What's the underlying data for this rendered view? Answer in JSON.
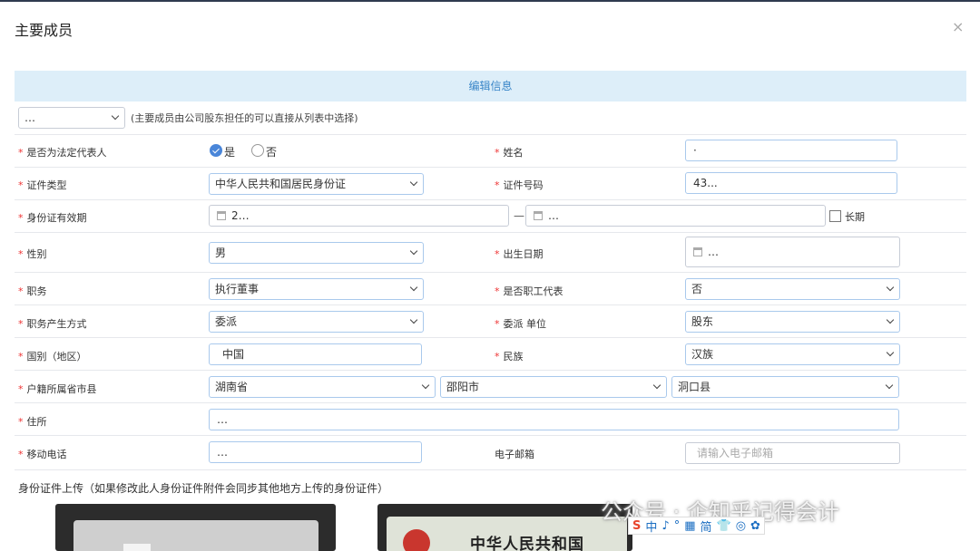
{
  "dialog": {
    "title": "主要成员",
    "close_icon": "×"
  },
  "banner": {
    "text": "编辑信息"
  },
  "member_select": {
    "value": "…",
    "hint": "(主要成员由公司股东担任的可以直接从列表中选择)"
  },
  "rows": {
    "legal_rep": {
      "label": "是否为法定代表人",
      "yes": "是",
      "no": "否",
      "selected": "是"
    },
    "name": {
      "label": "姓名",
      "value": "·"
    },
    "id_type": {
      "label": "证件类型",
      "value": "中华人民共和国居民身份证"
    },
    "id_number": {
      "label": "证件号码",
      "value": "43..."
    },
    "id_validity": {
      "label": "身份证有效期",
      "start": "2…",
      "end": "…",
      "long_term_label": "长期"
    },
    "gender": {
      "label": "性别",
      "value": "男"
    },
    "birth_date": {
      "label": "出生日期",
      "value": "…"
    },
    "position": {
      "label": "职务",
      "value": "执行董事"
    },
    "employee_rep": {
      "label": "是否职工代表",
      "value": "否"
    },
    "appointment_method": {
      "label": "职务产生方式",
      "value": "委派"
    },
    "appointing_unit": {
      "label": "委派 单位",
      "value": "股东"
    },
    "nationality": {
      "label": "国别（地区）",
      "value": "中国"
    },
    "ethnicity": {
      "label": "民族",
      "value": "汉族"
    },
    "household": {
      "label": "户籍所属省市县",
      "province": "湖南省",
      "city": "邵阳市",
      "county": "洞口县"
    },
    "address": {
      "label": "住所",
      "value": "…"
    },
    "mobile": {
      "label": "移动电话",
      "value": "…"
    },
    "email": {
      "label": "电子邮箱",
      "placeholder": "请输入电子邮箱"
    }
  },
  "upload": {
    "title": "身份证件上传（如果修改此人身份证件附件会同步其他地方上传的身份证件）",
    "id_back_text": "中华人民共和国"
  },
  "watermark": {
    "text": "公众号 · 企知乎记得会计"
  },
  "ime_toolbar": {
    "items": [
      "S",
      "中",
      "♪",
      "°",
      "▦",
      "简",
      "👕",
      "◎",
      "✿"
    ]
  },
  "colors": {
    "accent": "#3a86c8",
    "banner_bg": "#ddeef9",
    "required": "#ee3333",
    "radio_on": "#4a86d9"
  }
}
